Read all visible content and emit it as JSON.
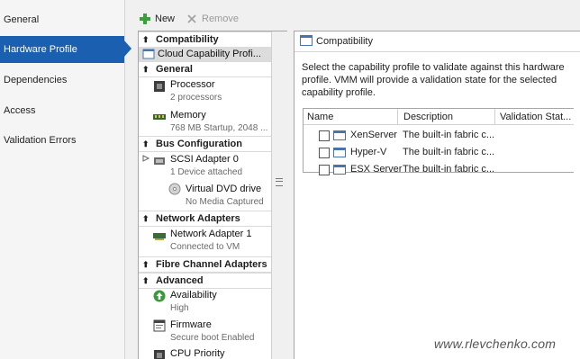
{
  "nav": {
    "items": [
      {
        "label": "General"
      },
      {
        "label": "Hardware Profile",
        "selected": true
      },
      {
        "label": "Dependencies"
      },
      {
        "label": "Access"
      },
      {
        "label": "Validation Errors"
      }
    ]
  },
  "toolbar": {
    "new_label": "New",
    "remove_label": "Remove"
  },
  "list": {
    "compatibility": {
      "header": "Compatibility",
      "item": "Cloud Capability Profi..."
    },
    "general": {
      "header": "General",
      "processor": {
        "title": "Processor",
        "sub": "2 processors"
      },
      "memory": {
        "title": "Memory",
        "sub": "768 MB Startup, 2048 ..."
      }
    },
    "bus": {
      "header": "Bus Configuration",
      "scsi": {
        "title": "SCSI Adapter 0",
        "sub": "1 Device attached"
      },
      "dvd": {
        "title": "Virtual DVD drive",
        "sub": "No Media Captured"
      }
    },
    "network": {
      "header": "Network Adapters",
      "adapter": {
        "title": "Network Adapter 1",
        "sub": "Connected to VM"
      }
    },
    "fibre": {
      "header": "Fibre Channel Adapters"
    },
    "advanced": {
      "header": "Advanced",
      "availability": {
        "title": "Availability",
        "sub": "High"
      },
      "firmware": {
        "title": "Firmware",
        "sub": "Secure boot Enabled"
      },
      "cpu": {
        "title": "CPU Priority"
      }
    }
  },
  "detail": {
    "title": "Compatibility",
    "description": "Select the capability profile to validate against this hardware profile. VMM will provide a validation state for the selected capability profile.",
    "columns": [
      "Name",
      "Description",
      "Validation Stat..."
    ],
    "rows": [
      {
        "name": "XenServer",
        "description": "The built-in fabric c..."
      },
      {
        "name": "Hyper-V",
        "description": "The built-in fabric c..."
      },
      {
        "name": "ESX Server",
        "description": "The built-in fabric c..."
      }
    ]
  },
  "watermark": "www.rlevchenko.com",
  "colors": {
    "nav_selected": "#1a5fb0",
    "new_icon": "#3aa13a",
    "panel_border": "#a6a6a6"
  }
}
